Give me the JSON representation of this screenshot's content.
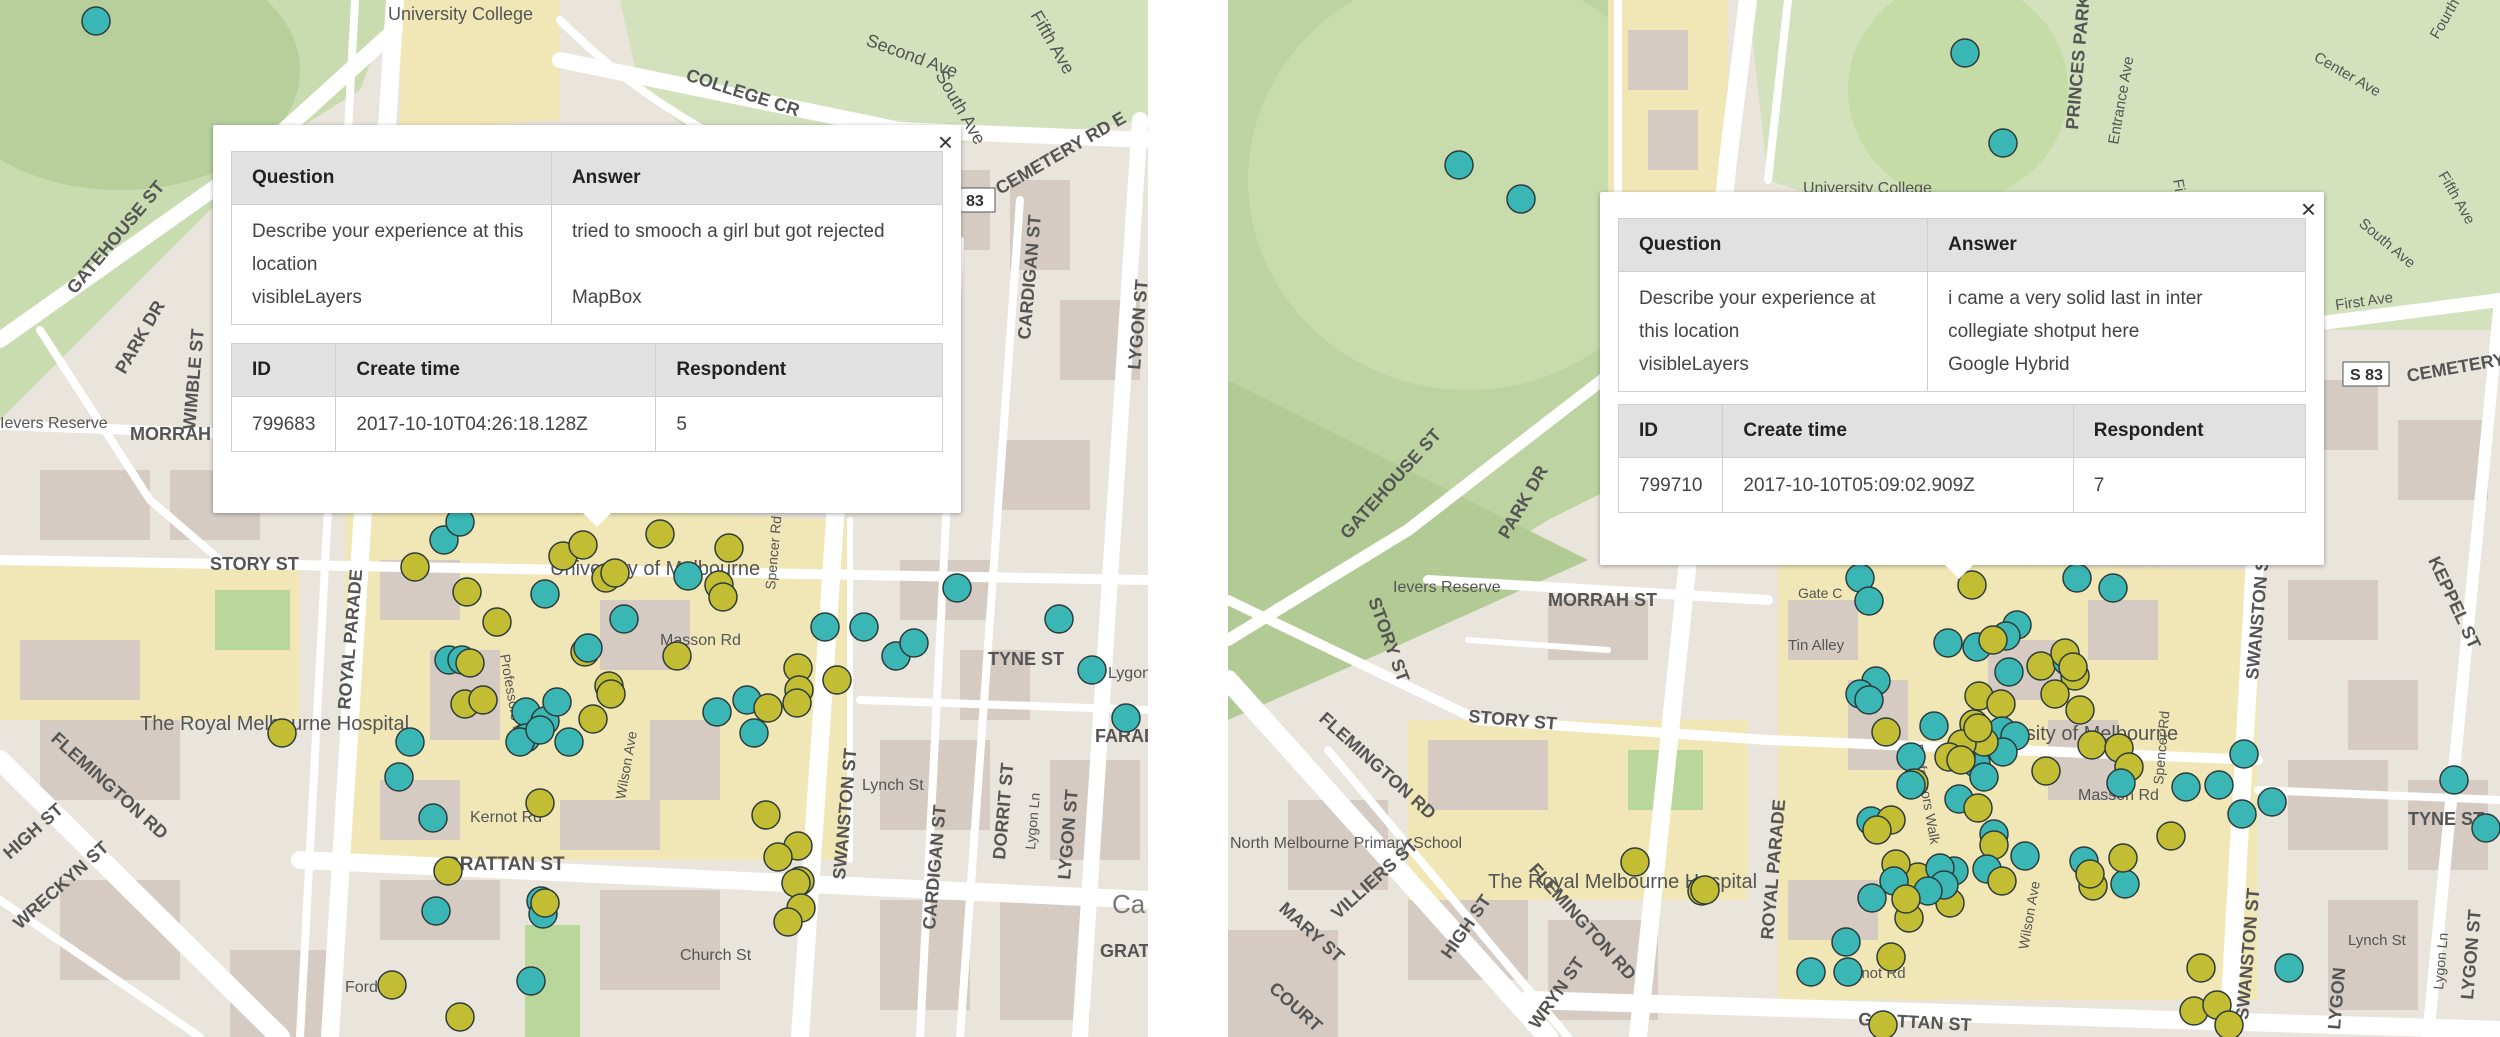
{
  "colors": {
    "teal_marker": "#3ab6b4",
    "olive_marker": "#c2bd32",
    "park": "#c9dcb0",
    "campus": "#f1e7b6",
    "road": "#ffffff",
    "building": "#d5cbc3"
  },
  "left": {
    "map_labels": {
      "university_college": "University College",
      "second_ave": "Second Ave",
      "fifth_ave": "Fifth Ave",
      "south_ave": "South Ave",
      "college_cr": "COLLEGE CR",
      "cemetery_rd": "CEMETERY RD E",
      "route_83": "83",
      "gatehouse_st": "GATEHOUSE ST",
      "park_dr": "PARK DR",
      "wimble_st": "WIMBLE ST",
      "ievers_reserve": "Ievers Reserve",
      "morrah": "MORRAH",
      "cardigan_st": "CARDIGAN ST",
      "lygon_st": "LYGON ST",
      "story_st": "STORY ST",
      "university_of_melbourne": "University of Melbourne",
      "spencer_rd": "Spencer Rd",
      "masson_rd": "Masson Rd",
      "tyne_st": "TYNE ST",
      "lygon_ct": "Lygon C",
      "faraday": "FARADA",
      "royal_parade": "ROYAL PARADE",
      "professors_walk": "Professors Walk",
      "wilson_ave": "Wilson Ave",
      "the_royal_melbourne_hospital": "The Royal Melbourne Hospital",
      "flemington_rd": "FLEMINGTON RD",
      "high_st": "HIGH ST",
      "wreckyn_st": "WRECKYN ST",
      "kernot_rd": "Kernot Rd",
      "grattan_st": "GRATTAN ST",
      "swanston_st": "SWANSTON ST",
      "lynch_st": "Lynch St",
      "dorrit_st": "DORRIT ST",
      "lygon_ln": "Lygon Ln",
      "cardigan_st2": "CARDIGAN ST",
      "church_st": "Church St",
      "ford": "Ford",
      "grat": "GRAT",
      "car": "Ca"
    },
    "popup": {
      "close": "×",
      "qa_headers": [
        "Question",
        "Answer"
      ],
      "rows": [
        {
          "q": "Describe your experience at this location",
          "a": "tried to smooch a girl but got rejected"
        },
        {
          "q": "visibleLayers",
          "a": "MapBox"
        }
      ],
      "meta_headers": [
        "ID",
        "Create time",
        "Respondent"
      ],
      "meta_values": [
        "799683",
        "2017-10-10T04:26:18.128Z",
        "5"
      ]
    }
  },
  "right": {
    "map_labels": {
      "princes_park": "PRINCES PARK",
      "entrance_ave": "Entrance Ave",
      "first_ave": "First Ave",
      "center_ave": "Center Ave",
      "fourth_ave": "Fourth Ave",
      "fifth_ave": "Fifth Ave",
      "south_ave": "South Ave",
      "cemetery_rd": "CEMETERY RD",
      "s83": "S 83",
      "university_college": "University College",
      "gatehouse_st": "GATEHOUSE ST",
      "park_dr": "PARK DR",
      "ievers_reserve": "Ievers Reserve",
      "morrah_st": "MORRAH ST",
      "story_st": "STORY ST",
      "story_st2": "STORY ST",
      "gate_c": "Gate C",
      "tin_alley": "Tin Alley",
      "university_of_melbourne": "University of Melbourne",
      "spencer_rd": "Spencer Rd",
      "masson_rd": "Masson Rd",
      "keppel_st": "KEPPEL ST",
      "tyne_st": "TYNE ST",
      "swanston_st": "SWANSTON ST",
      "flemington_rd": "FLEMINGTON RD",
      "flemington_rd2": "FLEMINGTON RD",
      "royal_parade": "ROYAL PARADE",
      "north_melbourne_primary": "North Melbourne Primary School",
      "the_royal_melbourne_hospital": "The Royal Melbourne Hospital",
      "mary_st": "MARY ST",
      "villiers_st": "VILLIERS ST",
      "high_st": "HIGH ST",
      "wreckyn_st": "WRYN ST",
      "kernot_rd": "Kernot Rd",
      "grattan_st": "GRATTAN ST",
      "lynch_st": "Lynch St",
      "lygon_ln": "Lygon Ln",
      "lygon_st": "LYGON ST",
      "professors_walk": "Professors Walk",
      "wilson_ave": "Wilson Ave",
      "court": "COURT",
      "lygon_st2": "LYGON"
    },
    "popup": {
      "close": "×",
      "qa_headers": [
        "Question",
        "Answer"
      ],
      "rows": [
        {
          "q": "Describe your experience at this location",
          "a": "i came a very solid last in inter collegiate shotput here"
        },
        {
          "q": "visibleLayers",
          "a": "Google Hybrid"
        }
      ],
      "meta_headers": [
        "ID",
        "Create time",
        "Respondent"
      ],
      "meta_values": [
        "799710",
        "2017-10-10T05:09:02.909Z",
        "7"
      ]
    }
  }
}
